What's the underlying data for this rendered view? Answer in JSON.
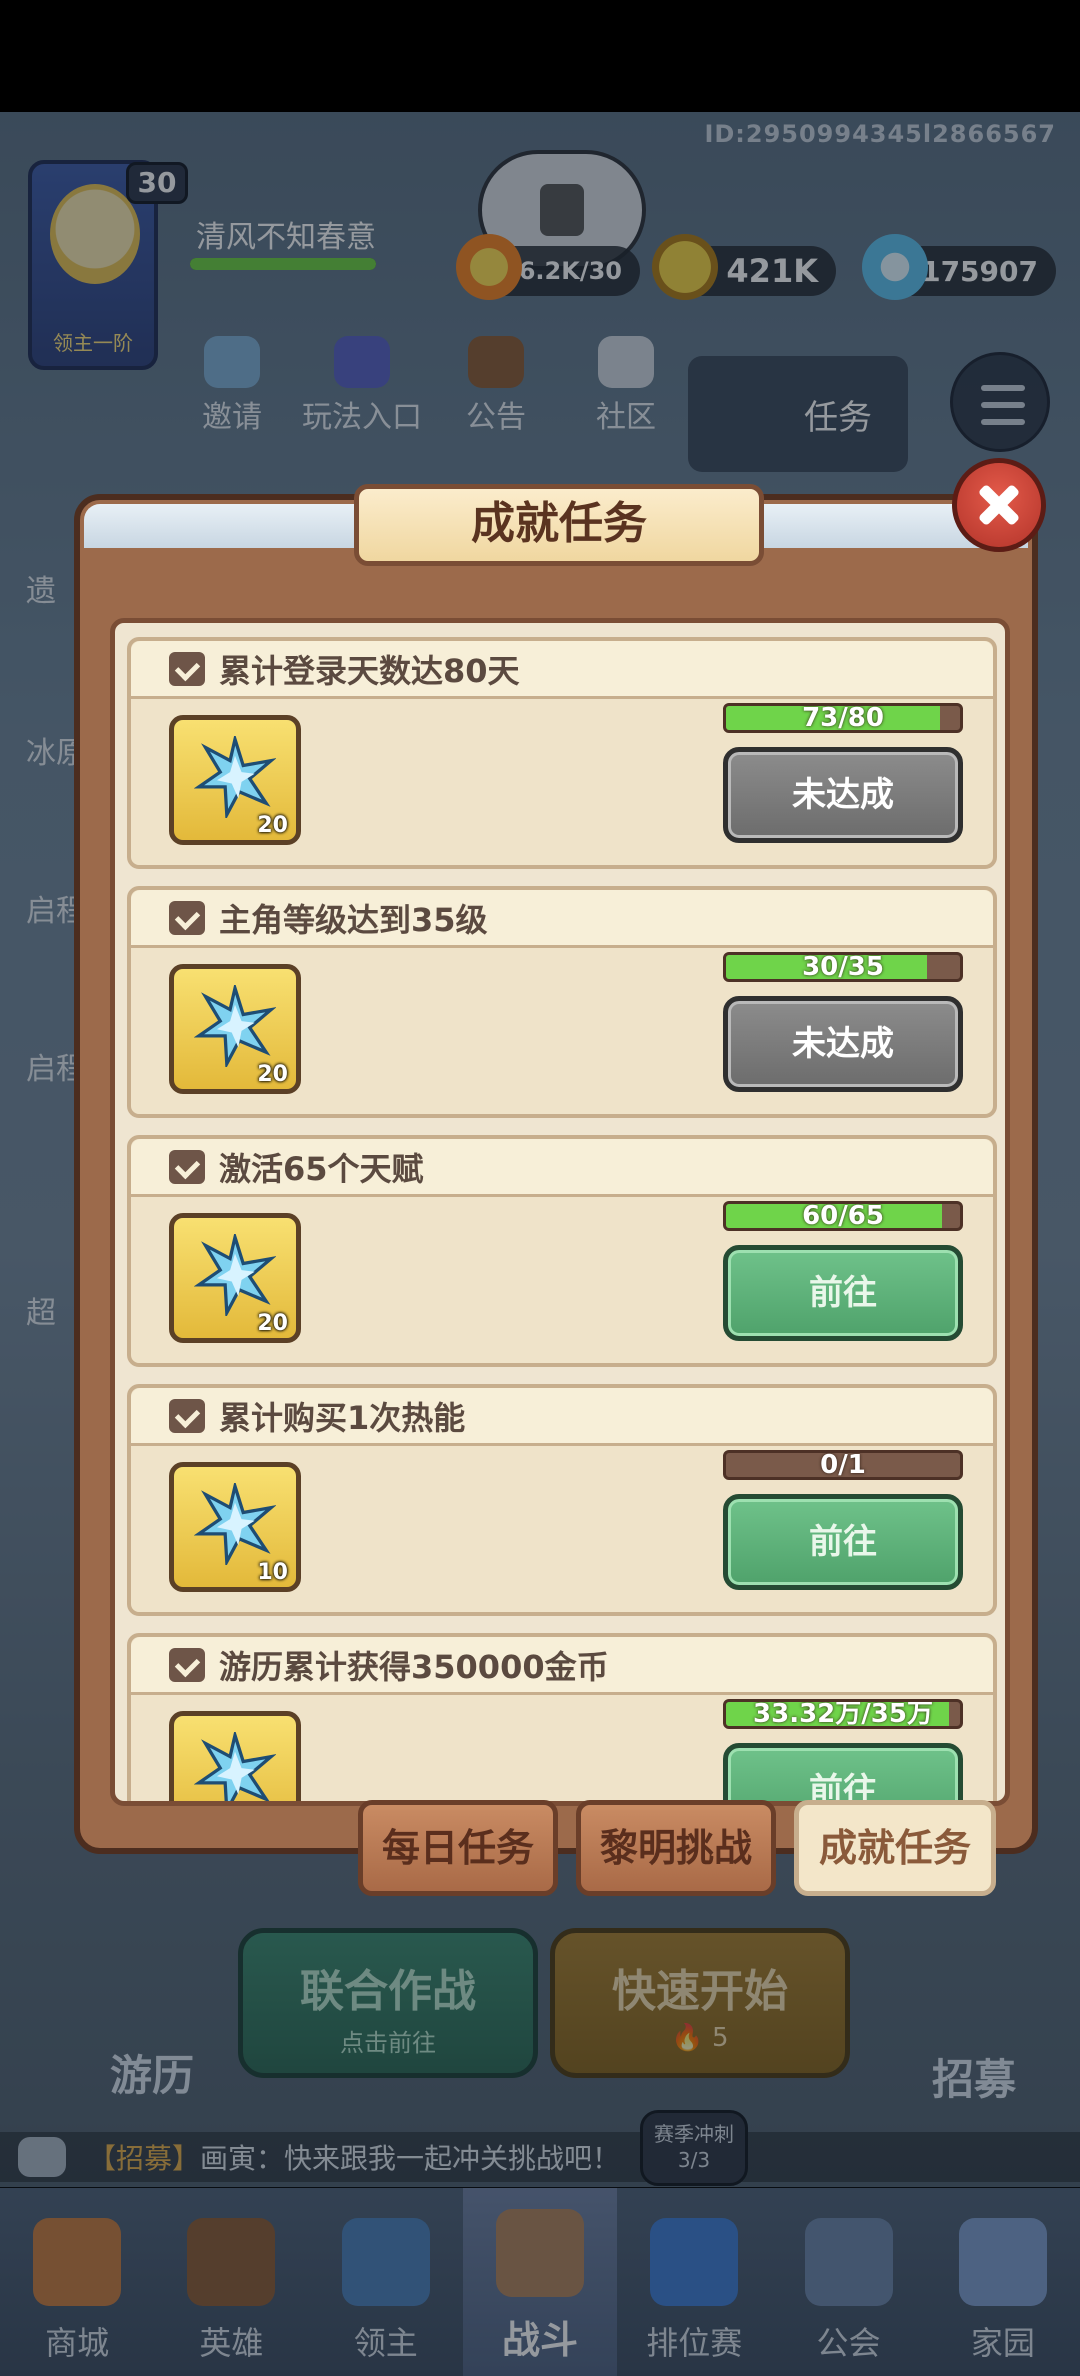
{
  "player": {
    "id": "ID:2950994345l2866567",
    "name": "清风不知春意",
    "level": "30",
    "rank": "领主一阶"
  },
  "resources": [
    {
      "icon": "flame-energy-icon",
      "value": "6.2K/30"
    },
    {
      "icon": "gold-coin-icon",
      "value": "421K"
    },
    {
      "icon": "crystal-icon",
      "value": "175907"
    }
  ],
  "top_nav": [
    "邀请",
    "玩法入口",
    "公告",
    "社区"
  ],
  "quest_button": "任务",
  "side_labels": [
    "遗",
    "冰原",
    "启程",
    "启程",
    "超"
  ],
  "popup": {
    "title": "成就任务",
    "tasks": [
      {
        "title": "累计登录天数达80天",
        "reward_qty": "20",
        "progress": "73/80",
        "fill": 0.9125,
        "button": "未达成",
        "state": "gray"
      },
      {
        "title": "主角等级达到35级",
        "reward_qty": "20",
        "progress": "30/35",
        "fill": 0.857,
        "button": "未达成",
        "state": "gray"
      },
      {
        "title": "激活65个天赋",
        "reward_qty": "20",
        "progress": "60/65",
        "fill": 0.923,
        "button": "前往",
        "state": "green"
      },
      {
        "title": "累计购买1次热能",
        "reward_qty": "10",
        "progress": "0/1",
        "fill": 0,
        "button": "前往",
        "state": "green"
      },
      {
        "title": "游历累计获得350000金币",
        "reward_qty": "",
        "progress": "33.32万/35万",
        "fill": 0.952,
        "button": "前往",
        "state": "green"
      }
    ],
    "tabs": [
      "每日任务",
      "黎明挑战",
      "成就任务"
    ],
    "active_tab": 2
  },
  "actions": {
    "coop_title": "联合作战",
    "coop_sub": "点击前往",
    "quick_title": "快速开始",
    "quick_cost": "5",
    "left_label": "游历",
    "right_label": "招募"
  },
  "chat": {
    "tag": "【招募】",
    "message": "画寅：快来跟我一起冲关挑战吧！"
  },
  "season": {
    "label": "赛季冲刺",
    "count": "3/3"
  },
  "bottom_nav": [
    {
      "label": "商城",
      "icon": "shop-icon",
      "color": "#c77b3d"
    },
    {
      "label": "英雄",
      "icon": "hero-card-icon",
      "color": "#8a5a32"
    },
    {
      "label": "领主",
      "icon": "lord-banner-icon",
      "color": "#4a7fb8"
    },
    {
      "label": "战斗",
      "icon": "crossed-swords-icon",
      "color": "#b0815a"
    },
    {
      "label": "排位赛",
      "icon": "rank-shield-icon",
      "color": "#3d7ad1"
    },
    {
      "label": "公会",
      "icon": "guild-castle-icon",
      "color": "#6b84a8"
    },
    {
      "label": "家园",
      "icon": "home-castle-icon",
      "color": "#7d9ccc"
    }
  ],
  "active_bottom": 3
}
